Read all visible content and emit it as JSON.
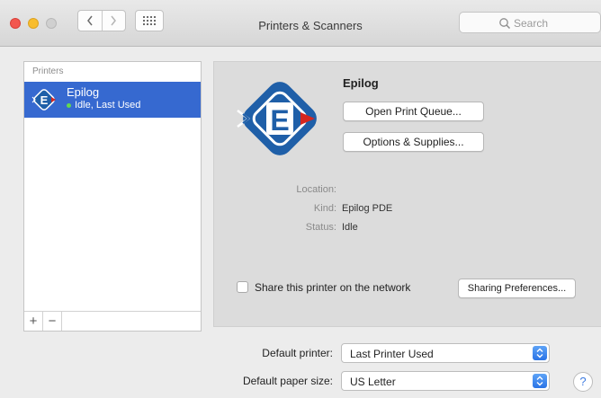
{
  "window": {
    "title": "Printers & Scanners"
  },
  "search": {
    "placeholder": "Search"
  },
  "printers": {
    "header": "Printers",
    "items": [
      {
        "name": "Epilog",
        "status": "Idle, Last Used",
        "icon_letter": "E"
      }
    ],
    "add_label": "+",
    "remove_label": "−"
  },
  "detail": {
    "name": "Epilog",
    "icon_letter": "E",
    "open_queue_label": "Open Print Queue...",
    "options_label": "Options & Supplies...",
    "location_label": "Location:",
    "location_value": "",
    "kind_label": "Kind:",
    "kind_value": "Epilog PDE",
    "status_label": "Status:",
    "status_value": "Idle",
    "share_label": "Share this printer on the network",
    "share_checked": false,
    "sharing_prefs_label": "Sharing Preferences..."
  },
  "defaults": {
    "printer_label": "Default printer:",
    "printer_value": "Last Printer Used",
    "paper_label": "Default paper size:",
    "paper_value": "US Letter"
  },
  "help_label": "?",
  "colors": {
    "selection": "#3669d0",
    "icon_blue": "#1f5fa8",
    "icon_red": "#d5261f",
    "status_green": "#63d94f"
  }
}
